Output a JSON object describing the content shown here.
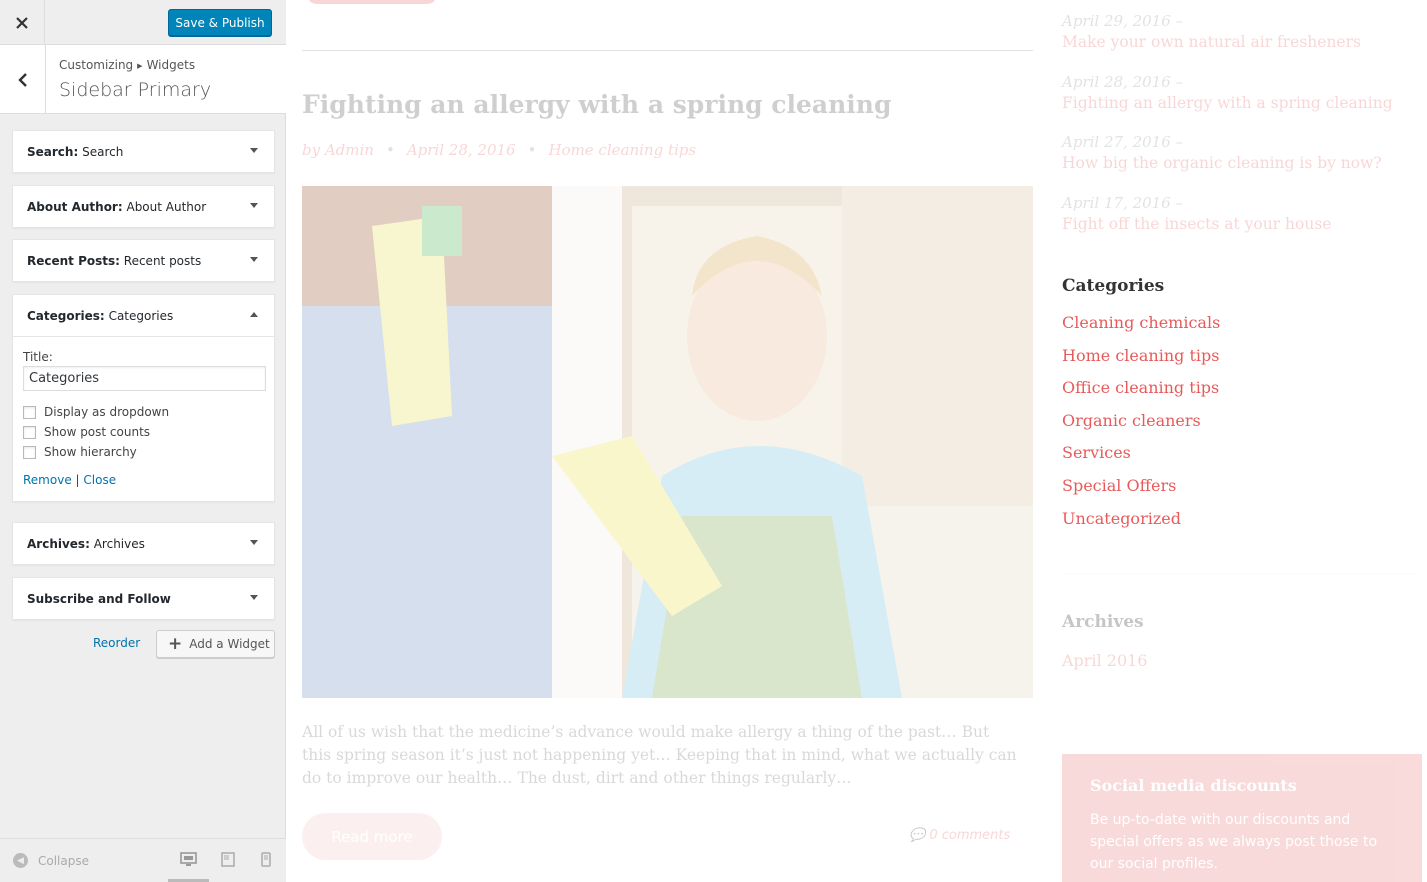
{
  "panel": {
    "close_icon": "close-icon",
    "publish_label": "Save & Publish",
    "breadcrumb": {
      "root": "Customizing",
      "section": "Widgets"
    },
    "title": "Sidebar Primary",
    "widgets": [
      {
        "type": "Search:",
        "name": "Search",
        "expanded": false
      },
      {
        "type": "About Author:",
        "name": "About Author",
        "expanded": false
      },
      {
        "type": "Recent Posts:",
        "name": "Recent posts",
        "expanded": false
      },
      {
        "type": "Categories:",
        "name": "Categories",
        "expanded": true
      },
      {
        "type": "Archives:",
        "name": "Archives",
        "expanded": false
      },
      {
        "type": "Subscribe and Follow",
        "name": "",
        "expanded": false
      }
    ],
    "categories_form": {
      "title_label": "Title:",
      "title_value": "Categories",
      "options": [
        "Display as dropdown",
        "Show post counts",
        "Show hierarchy"
      ],
      "remove_label": "Remove",
      "separator": "|",
      "close_label": "Close"
    },
    "reorder_label": "Reorder",
    "add_widget_label": "Add a Widget",
    "collapse_label": "Collapse",
    "devices": [
      "desktop-icon",
      "tablet-icon",
      "mobile-icon"
    ],
    "active_device": "desktop"
  },
  "preview": {
    "post": {
      "title": "Fighting an allergy with a spring cleaning",
      "author": "by Admin",
      "date": "April 28, 2016",
      "category": "Home cleaning tips",
      "excerpt": "All of us wish that the medicine’s advance would make allergy a thing of the past… But this spring season it’s just not happening yet… Keeping that in mind, what we actually can do to improve our health… The dust, dirt and other things regularly…",
      "read_more": "Read more",
      "comments": "0 comments"
    },
    "recent": [
      {
        "date": "April 29, 2016 –",
        "title": "Make your own natural air fresheners"
      },
      {
        "date": "April 28, 2016 –",
        "title": "Fighting an allergy with a spring cleaning"
      },
      {
        "date": "April 27, 2016 –",
        "title": "How big the organic cleaning is by now?"
      },
      {
        "date": "April 17, 2016 –",
        "title": "Fight off the insects at your house"
      }
    ],
    "categories_title": "Categories",
    "categories": [
      "Cleaning chemicals",
      "Home cleaning tips",
      "Office cleaning tips",
      "Organic cleaners",
      "Services",
      "Special Offers",
      "Uncategorized"
    ],
    "archives_title": "Archives",
    "archives": [
      "April 2016"
    ],
    "social": {
      "title": "Social media discounts",
      "text": "Be up-to-date with our discounts and special offers as we always post those to our social profiles."
    }
  },
  "colors": {
    "accent": "#0085ba",
    "link": "#0073aa",
    "theme_red": "#e85a5a"
  }
}
